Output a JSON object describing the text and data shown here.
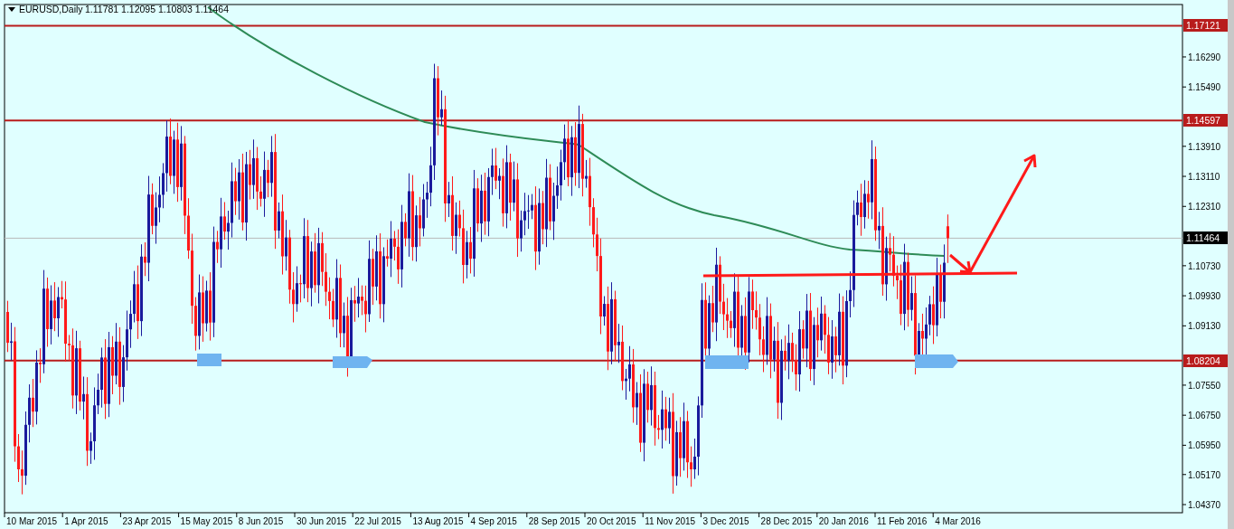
{
  "chart": {
    "symbol_label": "EURUSD,Daily",
    "ohlc": "1.11781 1.12095 1.10803 1.11464",
    "price_ticks": [
      "1.16290",
      "1.15490",
      "1.13910",
      "1.13110",
      "1.12310",
      "1.10730",
      "1.09930",
      "1.09130",
      "1.07550",
      "1.06750",
      "1.05950",
      "1.05170",
      "1.04370"
    ],
    "levels": [
      "1.17121",
      "1.14597",
      "1.08204"
    ],
    "current_price": "1.11464",
    "date_ticks": [
      "10 Mar 2015",
      "1 Apr 2015",
      "23 Apr 2015",
      "15 May 2015",
      "8 Jun 2015",
      "30 Jun 2015",
      "22 Jul 2015",
      "13 Aug 2015",
      "4 Sep 2015",
      "28 Sep 2015",
      "20 Oct 2015",
      "11 Nov 2015",
      "3 Dec 2015",
      "28 Dec 2015",
      "20 Jan 2016",
      "11 Feb 2016",
      "4 Mar 2016"
    ]
  }
}
